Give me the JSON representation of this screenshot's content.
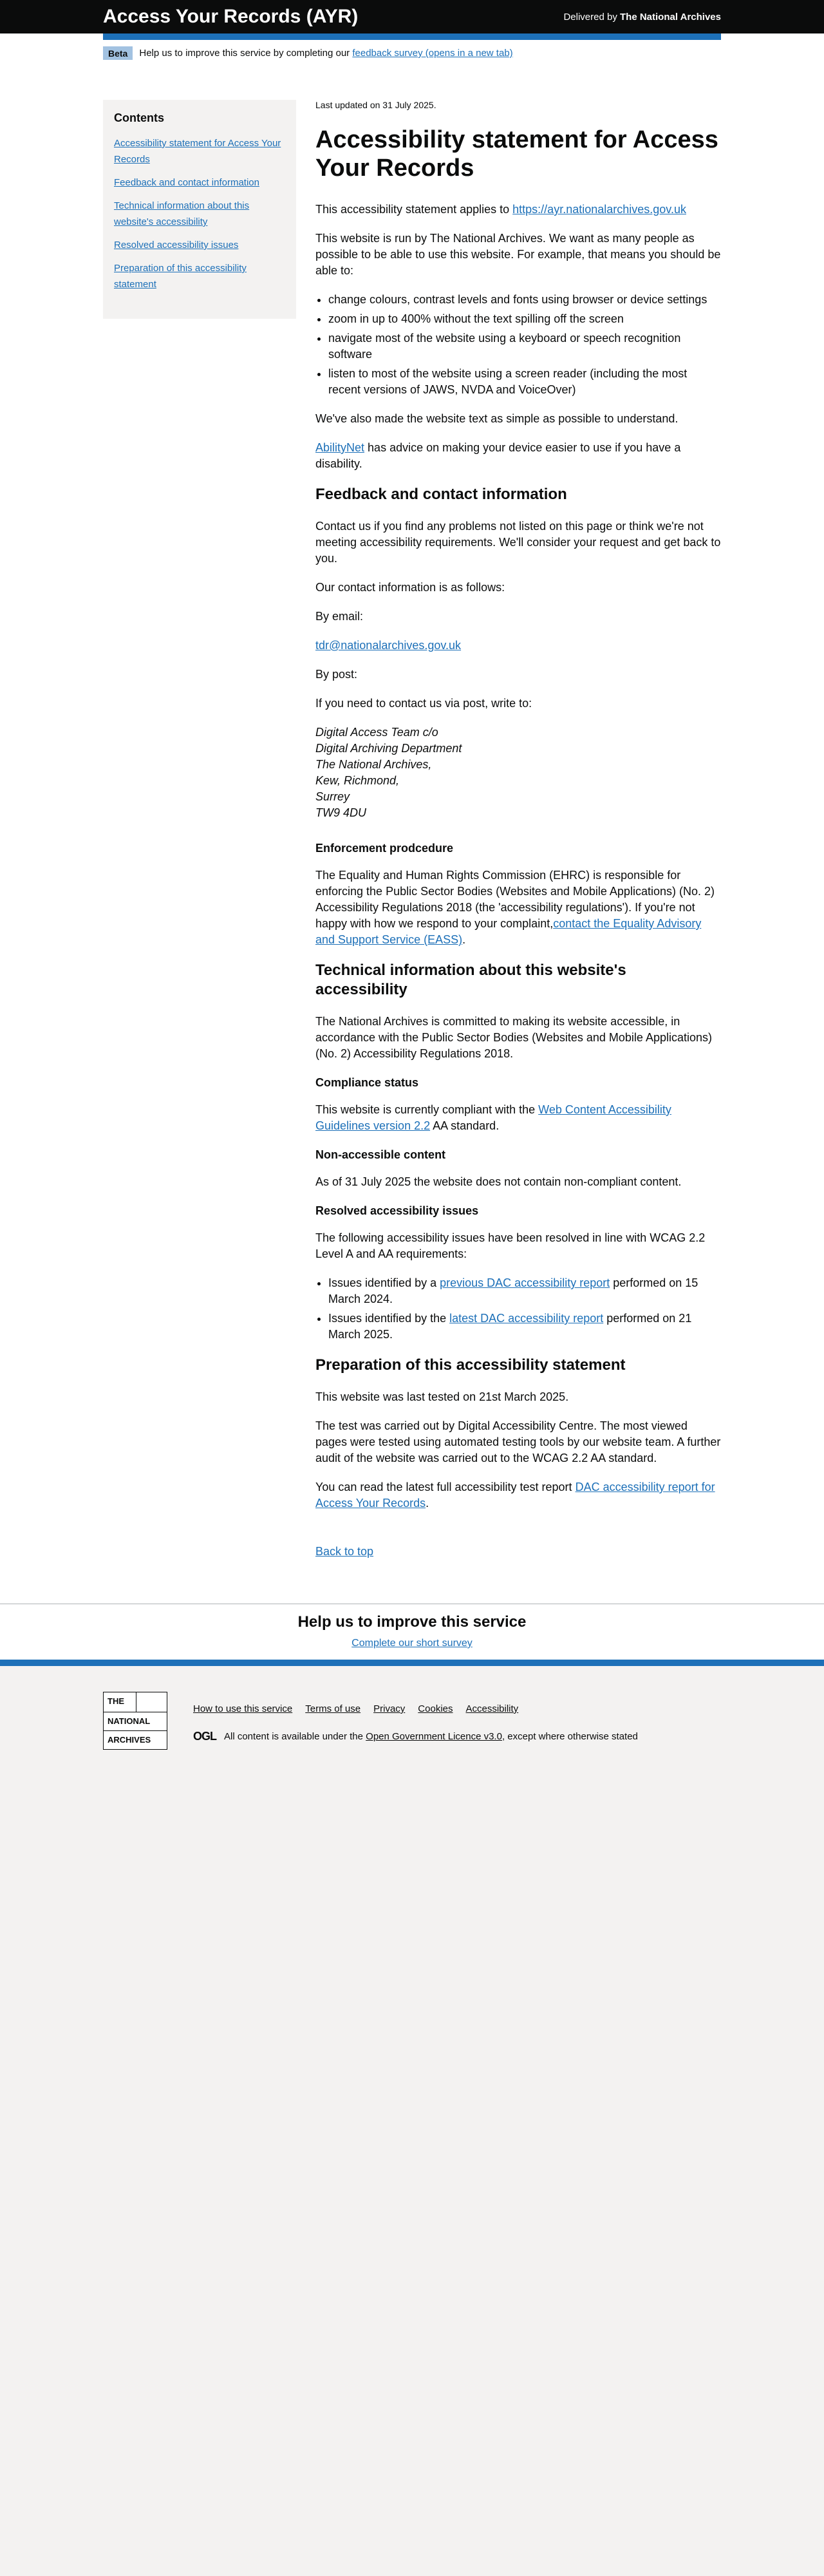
{
  "header": {
    "title": "Access Your Records (AYR)",
    "delivered_prefix": "Delivered by",
    "delivered_org": "The National Archives"
  },
  "beta": {
    "tag": "Beta",
    "text": "Help us to improve this service by completing our",
    "link": "feedback survey (opens in a new tab)"
  },
  "sidebar": {
    "title": "Contents",
    "items": [
      {
        "label": "Accessibility statement for Access Your Records"
      },
      {
        "label": "Feedback and contact information"
      },
      {
        "label": "Technical information about this website's accessibility"
      },
      {
        "label": "Resolved accessibility issues"
      },
      {
        "label": "Preparation of this accessibility statement"
      }
    ]
  },
  "main": {
    "updated": "Last updated on 31 July 2025.",
    "title": "Accessibility statement for Access Your Records",
    "applies_prefix": "This accessibility statement applies to",
    "applies_link": "https://ayr.nationalarchives.gov.uk",
    "run_by": "This website is run by The National Archives. We want as many people as possible to be able to use this website. For example, that means you should be able to:",
    "abilities": [
      "change colours, contrast levels and fonts using browser or device settings",
      "zoom in up to 400% without the text spilling off the screen",
      "navigate most of the website using a keyboard or speech recognition software",
      "listen to most of the website using a screen reader (including the most recent versions of JAWS, NVDA and VoiceOver)"
    ],
    "simple_text": "We've also made the website text as simple as possible to understand.",
    "abilitynet_link": "AbilityNet",
    "abilitynet_text": "has advice on making your device easier to use if you have a disability.",
    "feedback_heading": "Feedback and contact information",
    "contact_text": "Contact us if you find any problems not listed on this page or think we're not meeting accessibility requirements. We'll consider your request and get back to you.",
    "contact_info": "Our contact information is as follows:",
    "by_email": "By email:",
    "email": "tdr@nationalarchives.gov.uk",
    "by_post": "By post:",
    "post_intro": "If you need to contact us via post, write to:",
    "address": [
      "Digital Access Team c/o",
      "Digital Archiving Department",
      "The National Archives,",
      "Kew, Richmond,",
      "Surrey",
      "TW9 4DU"
    ],
    "enforcement_heading": "Enforcement prodcedure",
    "enforcement_text": "The Equality and Human Rights Commission (EHRC) is responsible for enforcing the Public Sector Bodies (Websites and Mobile Applications) (No. 2) Accessibility Regulations 2018 (the 'accessibility regulations'). If you're not happy with how we respond to your complaint,",
    "eass_link": "contact the Equality Advisory and Support Service (EASS)",
    "technical_heading": "Technical information about this website's accessibility",
    "technical_text": "The National Archives is committed to making its website accessible, in accordance with the Public Sector Bodies (Websites and Mobile Applications) (No. 2) Accessibility Regulations 2018.",
    "compliance_heading": "Compliance status",
    "compliance_prefix": "This website is currently compliant with the",
    "wcag_link": "Web Content Accessibility Guidelines version 2.2",
    "compliance_suffix": "AA standard.",
    "nonaccessible_heading": "Non-accessible content",
    "nonaccessible_text": "As of 31 July 2025 the website does not contain non-compliant content.",
    "resolved_heading": "Resolved accessibility issues",
    "resolved_text": "The following accessibility issues have been resolved in line with WCAG 2.2 Level A and AA requirements:",
    "resolved_items": [
      {
        "prefix": "Issues identified by a",
        "link": "previous DAC accessibility report",
        "suffix": "performed on 15 March 2024."
      },
      {
        "prefix": "Issues identified by the",
        "link": "latest DAC accessibility report",
        "suffix": "performed on 21 March 2025."
      }
    ],
    "preparation_heading": "Preparation of this accessibility statement",
    "tested_text": "This website was last tested on 21st March 2025.",
    "carried_text": "The test was carried out by Digital Accessibility Centre. The most viewed pages were tested using automated testing tools by our website team. A further audit of the website was carried out to the WCAG 2.2 AA standard.",
    "report_prefix": "You can read the latest full accessibility test report",
    "report_link": "DAC accessibility report for Access Your Records",
    "back_to_top": "Back to top"
  },
  "feedback": {
    "title": "Help us to improve this service",
    "link": "Complete our short survey"
  },
  "footer": {
    "logo_lines": [
      "THE",
      "NATIONAL",
      "ARCHIVES"
    ],
    "links": [
      "How to use this service",
      "Terms of use",
      "Privacy",
      "Cookies",
      "Accessibility"
    ],
    "ogl": "OGL",
    "licence_prefix": "All content is available under the",
    "licence_link": "Open Government Licence v3.0",
    "licence_suffix": ", except where otherwise stated"
  },
  "colors": {
    "header_bg": "#0b0c0c",
    "accent_blue": "#1d70b8",
    "beta_tag": "#a2c2e1",
    "page_bg": "#f3f2f1"
  }
}
